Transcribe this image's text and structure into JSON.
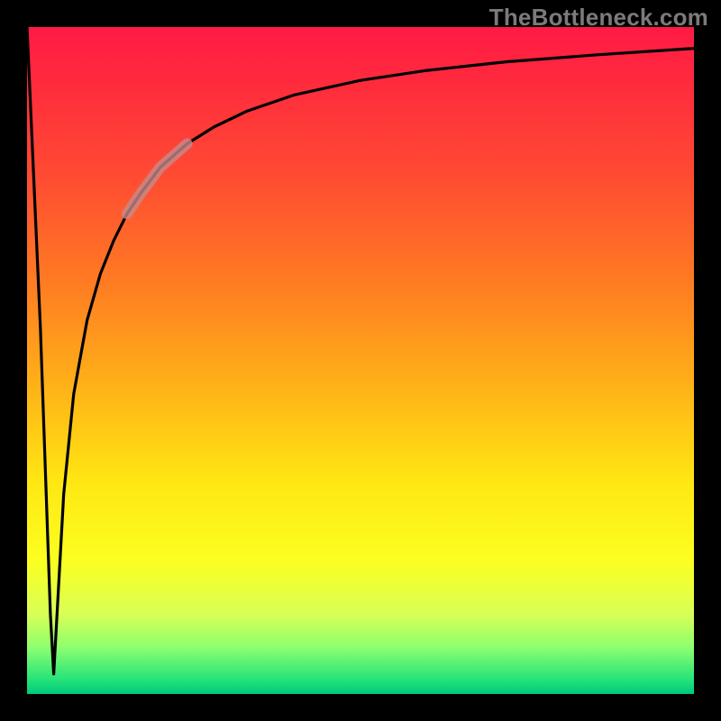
{
  "watermark": "TheBottleneck.com",
  "colors": {
    "curve": "#000000",
    "highlight": "#c58c8c",
    "gradient_top": "#ff1a45",
    "gradient_bottom": "#00c97a"
  },
  "chart_data": {
    "type": "line",
    "title": "",
    "xlabel": "",
    "ylabel": "",
    "xlim": [
      0,
      100
    ],
    "ylim": [
      0,
      100
    ],
    "grid": false,
    "legend": false,
    "notes": "Axes are unlabeled; gradient background runs red (top) → green (bottom). Curve is a sharp V near x≈4 (y drops from 100 to ≈3) then rises asymptotically toward y≈97 at x=100.",
    "series": [
      {
        "name": "bottleneck-curve",
        "x": [
          0,
          2,
          3.5,
          4,
          4.5,
          5.5,
          7,
          9,
          11,
          13,
          15,
          17,
          20,
          24,
          28,
          33,
          40,
          50,
          60,
          72,
          85,
          100
        ],
        "values": [
          100,
          55,
          12,
          3,
          12,
          30,
          45,
          56,
          63,
          68,
          72,
          75,
          79,
          82.5,
          85,
          87.4,
          89.8,
          92,
          93.5,
          94.8,
          95.8,
          96.8
        ]
      },
      {
        "name": "highlight-segment",
        "x": [
          15,
          17,
          20,
          24
        ],
        "values": [
          72,
          75,
          79,
          82.5
        ]
      }
    ]
  }
}
